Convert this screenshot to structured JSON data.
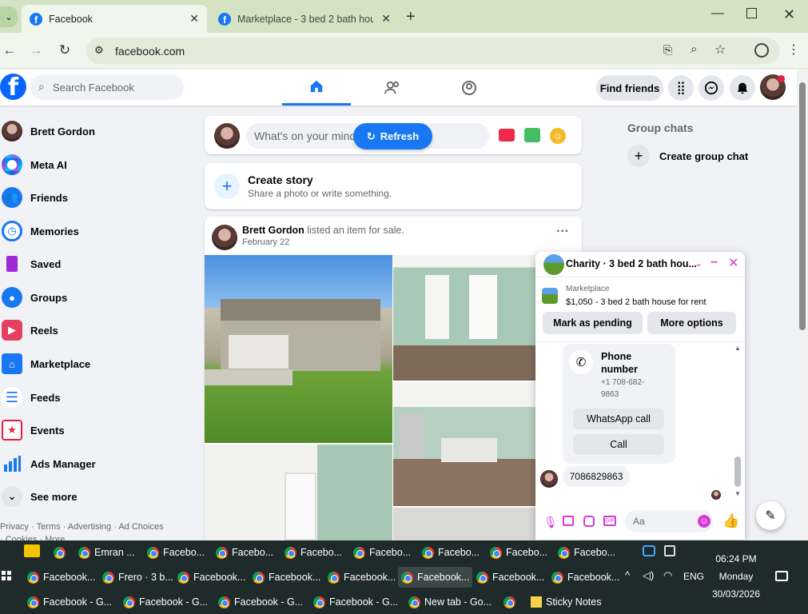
{
  "browser": {
    "tabs": [
      {
        "label": "Facebook",
        "active": true
      },
      {
        "label": "Marketplace - 3 bed 2 bath hou",
        "active": false
      }
    ],
    "url": "facebook.com"
  },
  "header": {
    "search_placeholder": "Search Facebook",
    "find_friends": "Find friends"
  },
  "sidebar": {
    "items": [
      {
        "label": "Brett Gordon"
      },
      {
        "label": "Meta AI"
      },
      {
        "label": "Friends"
      },
      {
        "label": "Memories"
      },
      {
        "label": "Saved"
      },
      {
        "label": "Groups"
      },
      {
        "label": "Reels"
      },
      {
        "label": "Marketplace"
      },
      {
        "label": "Feeds"
      },
      {
        "label": "Events"
      },
      {
        "label": "Ads Manager"
      },
      {
        "label": "See more"
      }
    ],
    "footer": "Privacy · Terms · Advertising · Ad Choices",
    "footer2": "· Cookies · More"
  },
  "composer": {
    "placeholder": "What's on your mind",
    "refresh": "Refresh"
  },
  "story": {
    "title": "Create story",
    "subtitle": "Share a photo or write something."
  },
  "post": {
    "author": "Brett Gordon",
    "action": "listed an item for sale.",
    "date": "February 22"
  },
  "right": {
    "group_chats": "Group chats",
    "create_group": "Create group chat"
  },
  "chat": {
    "title": "Charity · 3 bed 2 bath hou...",
    "marketplace_label": "Marketplace",
    "listing": "$1,050 - 3 bed 2 bath house for rent",
    "mark_pending": "Mark as pending",
    "more_options": "More options",
    "phone_title": "Phone number",
    "phone_value": "+1 708-682-9863",
    "whatsapp": "WhatsApp call",
    "call": "Call",
    "message": "7086829863",
    "input_placeholder": "Aa"
  },
  "taskbar": {
    "row1": [
      "Emran ...",
      "Facebo...",
      "Facebo...",
      "Facebo...",
      "Facebo...",
      "Facebo...",
      "Facebo...",
      "Facebo..."
    ],
    "row2": [
      "Facebook...",
      "Frero · 3 b...",
      "Facebook...",
      "Facebook...",
      "Facebook...",
      "Facebook...",
      "Facebook...",
      "Facebook..."
    ],
    "row3": [
      "Facebook - G...",
      "Facebook - G...",
      "Facebook - G...",
      "Facebook - G...",
      "New tab - Go...",
      "",
      "Sticky Notes"
    ],
    "lang": "ENG",
    "time": "06:24 PM",
    "day": "Monday",
    "date": "30/03/2026"
  },
  "colors": {
    "accent": "#1877f2",
    "chat_accent": "#d53ad5",
    "taskbar": "#1f2a2a"
  }
}
